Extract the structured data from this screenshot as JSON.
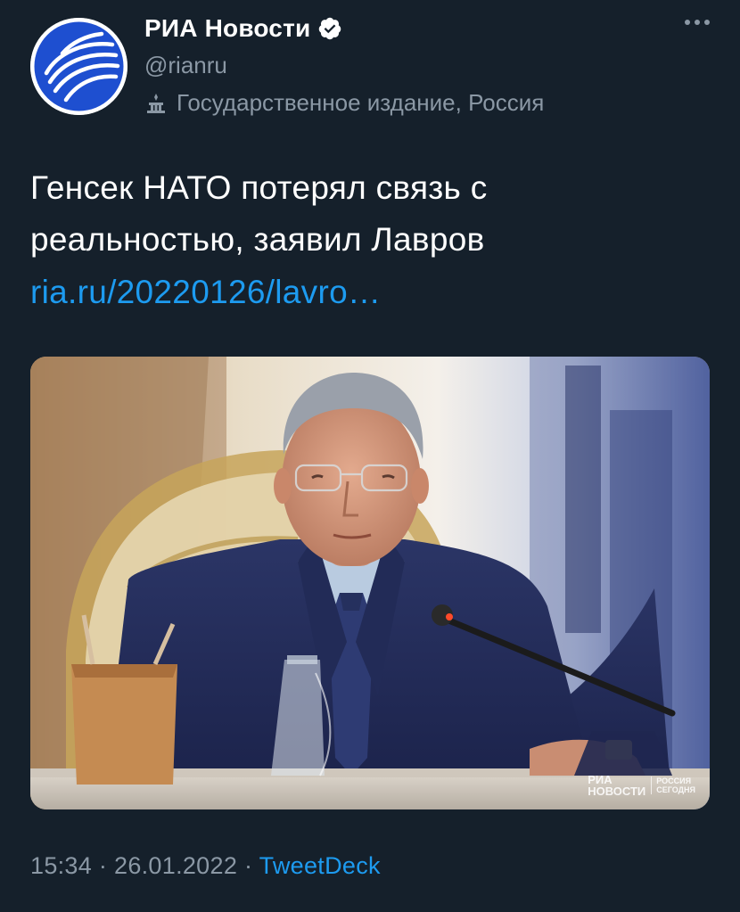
{
  "author": {
    "display_name": "РИА Новости",
    "handle": "@rianru",
    "label": "Государственное издание, Россия",
    "avatar_icon": "ria-logo-icon",
    "verified_icon": "verified-badge-icon",
    "label_icon": "state-media-icon"
  },
  "tweet": {
    "text": "Генсек НАТО потерял связь с реальностью, заявил Лавров",
    "link": "ria.ru/20220126/lavro…",
    "media_watermark": {
      "main_line1": "РИА",
      "main_line2": "НОВОСТИ",
      "sub_line1": "РОССИЯ",
      "sub_line2": "СЕГОДНЯ"
    }
  },
  "meta": {
    "time": "15:34",
    "separator": "·",
    "date": "26.01.2022",
    "source": "TweetDeck"
  },
  "colors": {
    "background": "#15202b",
    "text": "#ffffff",
    "secondary": "#8b98a5",
    "link": "#1d9bf0",
    "brand": "#1e4fd0"
  }
}
